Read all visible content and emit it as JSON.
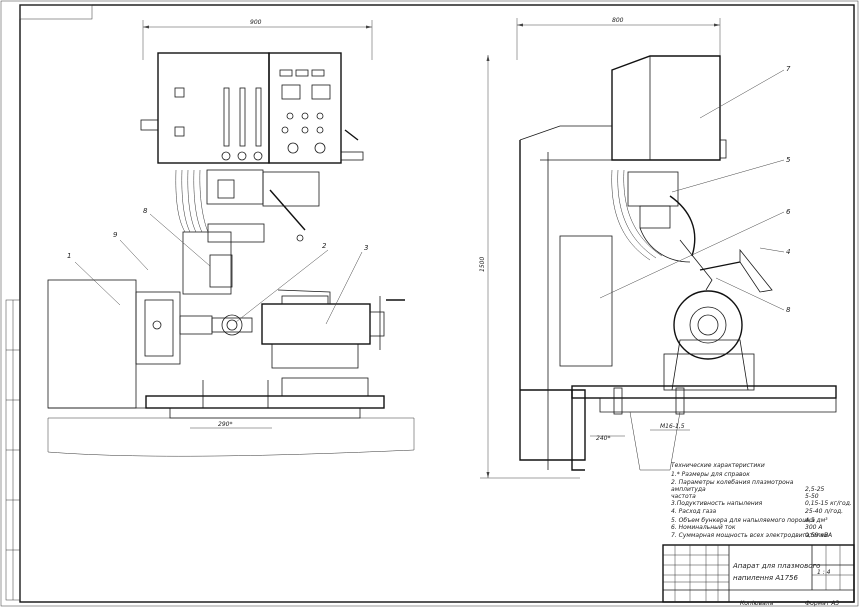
{
  "dimensions": {
    "left_width": "900",
    "right_width": "800",
    "height": "1500",
    "base_span": "290*",
    "right_offset": "240*",
    "bolt": "M16-1,5"
  },
  "callouts": {
    "c1": "1",
    "c2": "2",
    "c3": "3",
    "c8a": "8",
    "c9": "9",
    "c4": "4",
    "c5": "5",
    "c6": "6",
    "c7": "7",
    "c8b": "8"
  },
  "specs": {
    "heading": "Технические характеристики",
    "lines": [
      {
        "label": "1.* Размеры для справок",
        "value": ""
      },
      {
        "label": "2. Параметры колебания плазмотрона",
        "value": ""
      },
      {
        "label": "   амплитуда",
        "value": "2,5-25"
      },
      {
        "label": "   частота",
        "value": "5-50"
      },
      {
        "label": "3.Подуктивность напыления",
        "value": "0,15-15 кг/год."
      },
      {
        "label": "4. Расход газа",
        "value": "25-40 л/год."
      },
      {
        "label": "5. Объем бункера для напыляемого порошка",
        "value": "4,5 дм³"
      },
      {
        "label": "6. Номинальный ток",
        "value": "300 А"
      },
      {
        "label": "7. Суммарная мощность всех электродвигателей",
        "value": "0,59 кВА"
      }
    ]
  },
  "title_block": {
    "title_line1": "Апарат для плазмового",
    "title_line2": "напилення А1756",
    "sheet_scale": "1 : 4",
    "bottom_left": "Копіювала",
    "bottom_right": "Формат    А3"
  }
}
